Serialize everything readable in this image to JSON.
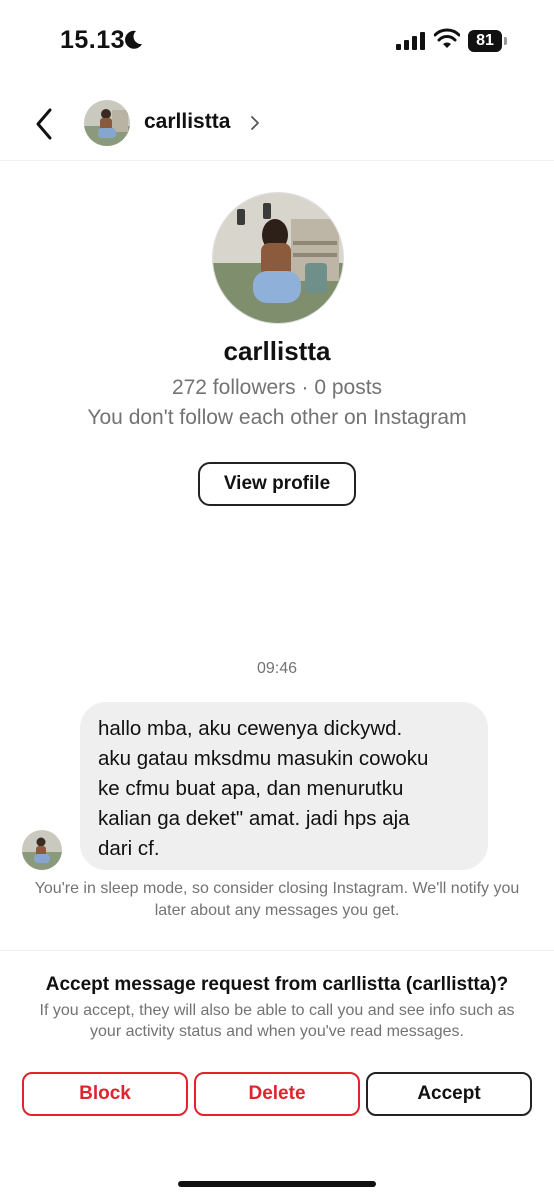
{
  "status_bar": {
    "time": "15.13",
    "battery": "81"
  },
  "header": {
    "username": "carllistta"
  },
  "profile": {
    "name": "carllistta",
    "stats": "272 followers · 0 posts",
    "relation": "You don't follow each other on Instagram",
    "view_profile_label": "View profile"
  },
  "chat": {
    "timestamp": "09:46",
    "message": "hallo mba, aku cewenya dickywd.\naku gatau mksdmu masukin cowoku\nke cfmu buat apa, dan menurutku\nkalian ga deket\" amat. jadi hps aja\ndari cf.",
    "sleep_note": "You're in sleep mode, so consider closing Instagram. We'll notify you later about any messages you get."
  },
  "request": {
    "title": "Accept message request from carllistta (carllistta)?",
    "description": "If you accept, they will also be able to call you and see info such as your activity status and when you've read messages.",
    "block_label": "Block",
    "delete_label": "Delete",
    "accept_label": "Accept"
  },
  "colors": {
    "destructive": "#e0242e",
    "secondary_text": "#737373",
    "bubble": "#efefef"
  },
  "icons": [
    "moon-icon",
    "cellular-signal-icon",
    "wifi-icon",
    "battery-icon",
    "back-arrow-icon",
    "chevron-right-icon"
  ]
}
